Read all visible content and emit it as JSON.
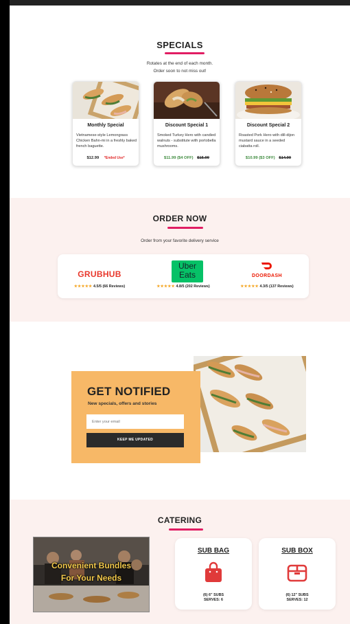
{
  "specials": {
    "title": "SPECIALS",
    "subtitle_line1": "Rotates at the end of each month.",
    "subtitle_line2": "Order soon to not miss out!",
    "cards": [
      {
        "title": "Monthly Special",
        "description": "Vietnamese-style Lemongrass Chicken Bahn-mi in a freshly baked french baguette.",
        "price": "$12.99",
        "note": "*Ended Use*"
      },
      {
        "title": "Discount Special 1",
        "description": "Smoked Turkey Hero with candied walnuts - substitute with portobella mushrooms.",
        "price": "$11.99 ($4 OFF)",
        "old_price": "$15.99"
      },
      {
        "title": "Discount Special 2",
        "description": "Roasted Pork Hero with dill-dijon mustard sauce in a seeded ciabatta roll.",
        "price": "$10.99 ($3 OFF)",
        "old_price": "$14.99"
      }
    ]
  },
  "order": {
    "title": "ORDER NOW",
    "subtitle": "Order from your favorite delivery service",
    "services": [
      {
        "name": "GRUBHUB",
        "stars": "★★★★★",
        "rating": "4.5/5 (66 Reviews)",
        "color": "#e8372b"
      },
      {
        "name_line1": "Uber",
        "name_line2": "Eats",
        "stars": "★★★★★",
        "rating": "4.8/5 (202 Reviews)",
        "color": "#06c167"
      },
      {
        "name": "DOORDASH",
        "stars": "★★★★★",
        "rating": "4.3/5 (137 Reviews)",
        "color": "#eb1700"
      }
    ]
  },
  "notify": {
    "title": "GET NOTIFIED",
    "subtitle": "New specials, offers and stories",
    "email_placeholder": "Enter your email",
    "button_label": "KEEP ME UPDATED"
  },
  "catering": {
    "title": "CATERING",
    "banner_line1": "Convenient Bundles",
    "banner_line2": "For Your Needs",
    "options": [
      {
        "title": "SUB BAG",
        "line1": "(6) 6\" SUBS",
        "line2": "SERVES: 6",
        "icon": "shopping-bag-icon"
      },
      {
        "title": "SUB BOX",
        "line1": "(6) 12\" SUBS",
        "line2": "SERVES: 12",
        "icon": "box-icon"
      }
    ]
  },
  "colors": {
    "accent": "#e11d63",
    "notify_bg": "#f7b867",
    "section_bg": "#fcf1ef",
    "discount_green": "#3c8a3c",
    "note_red": "#e02424"
  }
}
